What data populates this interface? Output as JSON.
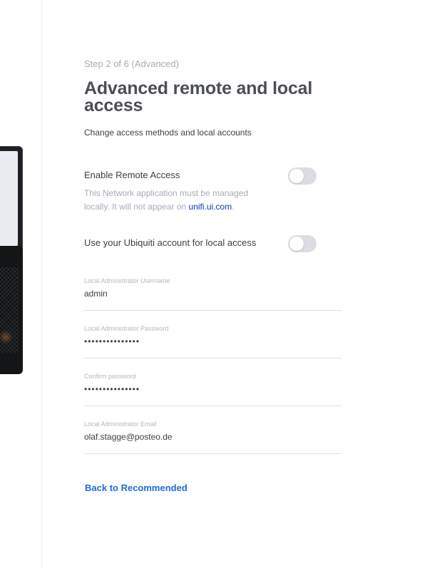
{
  "step": {
    "label": "Step 2 of 6 (Advanced)"
  },
  "header": {
    "title": "Advanced remote and local access",
    "subtitle": "Change access methods and local accounts"
  },
  "remote_access": {
    "label": "Enable Remote Access",
    "enabled": false,
    "note_prefix": "This Network application must be managed locally. It will not appear on ",
    "note_link": "unifi.ui.com",
    "note_suffix": "."
  },
  "ubiquiti_account": {
    "label": "Use your Ubiquiti account for local access",
    "enabled": false
  },
  "fields": {
    "username": {
      "label": "Local Administrator Username",
      "value": "admin"
    },
    "password": {
      "label": "Local Administrator Password",
      "value": "•••••••••••••••"
    },
    "confirm_password": {
      "label": "Confirm password",
      "value": "•••••••••••••••"
    },
    "email": {
      "label": "Local Administrator Email",
      "value": "olaf.stagge@posteo.de"
    }
  },
  "back_link": {
    "label": "Back to Recommended"
  },
  "colors": {
    "accent_link": "#1f6bd9",
    "note_link": "#1033bd",
    "toggle_off": "#dcdde3",
    "title": "#4b4e55",
    "muted": "#a6abb6"
  }
}
